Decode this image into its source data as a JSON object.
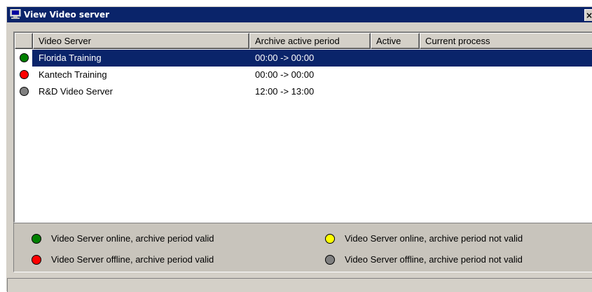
{
  "window": {
    "title": "View Video server",
    "close_glyph": "×"
  },
  "table": {
    "columns": [
      "Video Server",
      "Archive active period",
      "Active",
      "Current process"
    ],
    "rows": [
      {
        "status": "green",
        "name": "Florida Training",
        "period": "00:00 -> 00:00",
        "active": "",
        "process": "",
        "selected": true
      },
      {
        "status": "red",
        "name": "Kantech Training",
        "period": "00:00 -> 00:00",
        "active": "",
        "process": "",
        "selected": false
      },
      {
        "status": "gray",
        "name": "R&D Video Server",
        "period": "12:00 -> 13:00",
        "active": "",
        "process": "",
        "selected": false
      }
    ]
  },
  "legend": {
    "items": [
      {
        "color": "green",
        "label": "Video Server online, archive period valid"
      },
      {
        "color": "yellow",
        "label": "Video Server online, archive period not valid"
      },
      {
        "color": "red",
        "label": "Video Server offline, archive period valid"
      },
      {
        "color": "gray",
        "label": "Video Server offline, archive period not valid"
      }
    ]
  },
  "colors": {
    "green": "#008000",
    "red": "#ff0000",
    "gray": "#808080",
    "yellow": "#ffff00",
    "title_bar": "#0a246a",
    "selection": "#0a246a"
  }
}
